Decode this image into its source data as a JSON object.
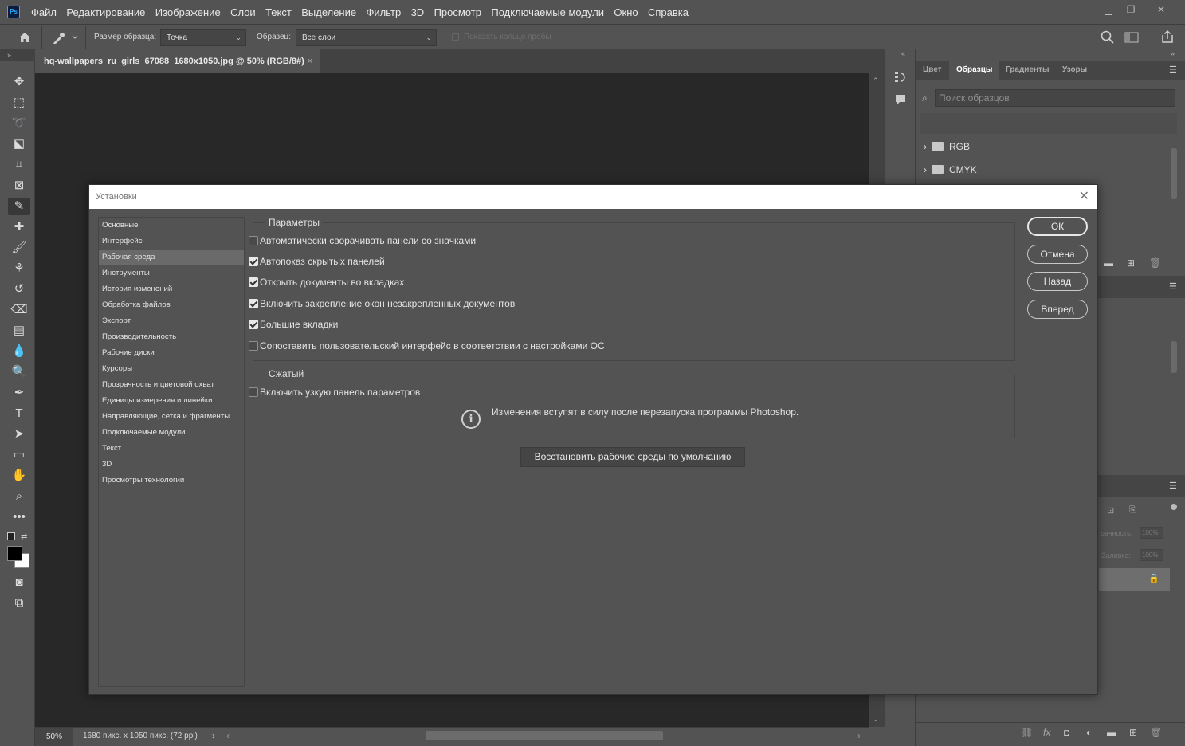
{
  "app": {
    "logo": "Ps"
  },
  "menubar": {
    "items": [
      "Файл",
      "Редактирование",
      "Изображение",
      "Слои",
      "Текст",
      "Выделение",
      "Фильтр",
      "3D",
      "Просмотр",
      "Подключаемые модули",
      "Окно",
      "Справка"
    ]
  },
  "window_controls": {
    "minimize": "▁",
    "restore": "❐",
    "close": "✕"
  },
  "options": {
    "sample_size_label": "Размер образца:",
    "sample_size_value": "Точка",
    "sample_label": "Образец:",
    "sample_value": "Все слои",
    "show_ring_label": "Показать кольцо пробы"
  },
  "document": {
    "tab_title": "hq-wallpapers_ru_girls_67088_1680x1050.jpg @ 50% (RGB/8#)",
    "tab_close": "×",
    "zoom": "50%",
    "doc_info": "1680 пикс. x 1050 пикс. (72 ppi)"
  },
  "right_panel": {
    "tabs": [
      "Цвет",
      "Образцы",
      "Градиенты",
      "Узоры"
    ],
    "active_tab": "Образцы",
    "search_placeholder": "Поиск образцов",
    "folders": [
      "RGB",
      "CMYK"
    ],
    "layers": {
      "opacity_label": "рачность:",
      "opacity_value": "100%",
      "fill_label": "Заливка:",
      "fill_value": "100%"
    }
  },
  "dialog": {
    "title": "Установки",
    "nav": [
      "Основные",
      "Интерфейс",
      "Рабочая среда",
      "Инструменты",
      "История изменений",
      "Обработка файлов",
      "Экспорт",
      "Производительность",
      "Рабочие диски",
      "Курсоры",
      "Прозрачность и цветовой охват",
      "Единицы измерения и линейки",
      "Направляющие, сетка и фрагменты",
      "Подключаемые модули",
      "Текст",
      "3D",
      "Просмотры технологии"
    ],
    "selected_nav": "Рабочая среда",
    "options_group_title": "Параметры",
    "options": [
      {
        "label": "Автоматически сворачивать панели со значками",
        "checked": false
      },
      {
        "label": "Автопоказ скрытых панелей",
        "checked": true
      },
      {
        "label": "Открыть документы во вкладках",
        "checked": true
      },
      {
        "label": "Включить закрепление окон незакрепленных документов",
        "checked": true
      },
      {
        "label": "Большие вкладки",
        "checked": true
      },
      {
        "label": "Сопоставить пользовательский интерфейс в соответствии с настройками ОС",
        "checked": false
      }
    ],
    "compact_group_title": "Сжатый",
    "compact_option": {
      "label": "Включить узкую панель параметров",
      "checked": false
    },
    "info_text": "Изменения вступят в силу после перезапуска программы Photoshop.",
    "reset_button": "Восстановить рабочие среды по умолчанию",
    "buttons": {
      "ok": "ОК",
      "cancel": "Отмена",
      "back": "Назад",
      "forward": "Вперед"
    }
  }
}
